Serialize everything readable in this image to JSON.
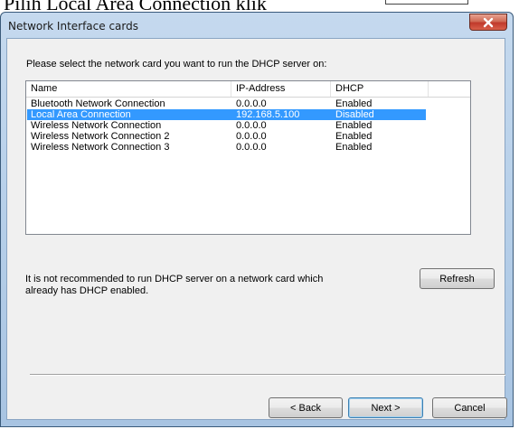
{
  "background_text": {
    "caption": "Pilih Local Area Connection klik"
  },
  "window": {
    "title": "Network Interface cards",
    "close_label": "X"
  },
  "prompt": "Please select the network card you want to run the DHCP server on:",
  "list": {
    "columns": [
      "Name",
      "IP-Address",
      "DHCP"
    ],
    "rows": [
      {
        "name": "Bluetooth Network Connection",
        "ip": "0.0.0.0",
        "dhcp": "Enabled",
        "selected": false
      },
      {
        "name": "Local Area Connection",
        "ip": "192.168.5.100",
        "dhcp": "Disabled",
        "selected": true
      },
      {
        "name": "Wireless Network Connection",
        "ip": "0.0.0.0",
        "dhcp": "Enabled",
        "selected": false
      },
      {
        "name": "Wireless Network Connection 2",
        "ip": "0.0.0.0",
        "dhcp": "Enabled",
        "selected": false
      },
      {
        "name": "Wireless Network Connection 3",
        "ip": "0.0.0.0",
        "dhcp": "Enabled",
        "selected": false
      }
    ]
  },
  "note": "It is not recommended to run DHCP server on a network card which already has DHCP enabled.",
  "buttons": {
    "refresh": "Refresh",
    "back": "< Back",
    "next": "Next >",
    "cancel": "Cancel"
  },
  "colors": {
    "selection": "#3399ff",
    "close_button": "#c0392b"
  }
}
